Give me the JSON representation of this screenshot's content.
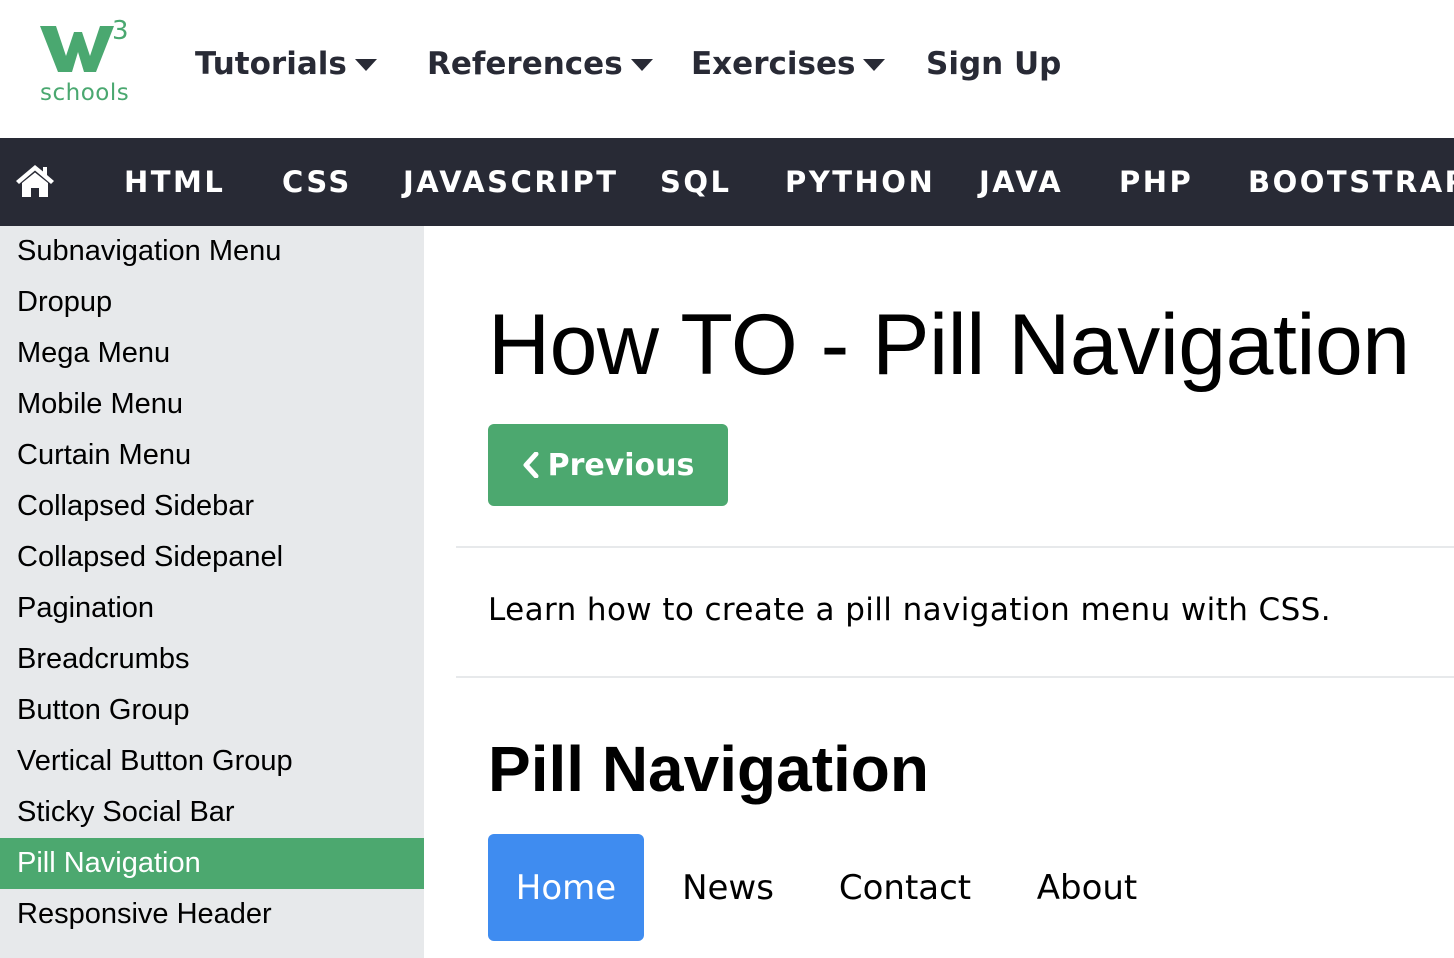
{
  "brand": {
    "logo_mark": "w",
    "logo_superscript": "3",
    "logo_text": "schools",
    "color": "#4aa870"
  },
  "topnav": {
    "items": [
      {
        "label": "Tutorials",
        "dropdown": true
      },
      {
        "label": "References",
        "dropdown": true
      },
      {
        "label": "Exercises",
        "dropdown": true
      },
      {
        "label": "Sign Up",
        "dropdown": false
      }
    ]
  },
  "darknav": {
    "home_icon": "home-icon",
    "items": [
      "HTML",
      "CSS",
      "JAVASCRIPT",
      "SQL",
      "PYTHON",
      "JAVA",
      "PHP",
      "BOOTSTRAP"
    ],
    "background": "#282a35"
  },
  "sidebar": {
    "items": [
      {
        "label": "Subnavigation Menu",
        "active": false
      },
      {
        "label": "Dropup",
        "active": false
      },
      {
        "label": "Mega Menu",
        "active": false
      },
      {
        "label": "Mobile Menu",
        "active": false
      },
      {
        "label": "Curtain Menu",
        "active": false
      },
      {
        "label": "Collapsed Sidebar",
        "active": false
      },
      {
        "label": "Collapsed Sidepanel",
        "active": false
      },
      {
        "label": "Pagination",
        "active": false
      },
      {
        "label": "Breadcrumbs",
        "active": false
      },
      {
        "label": "Button Group",
        "active": false
      },
      {
        "label": "Vertical Button Group",
        "active": false
      },
      {
        "label": "Sticky Social Bar",
        "active": false
      },
      {
        "label": "Pill Navigation",
        "active": true
      },
      {
        "label": "Responsive Header",
        "active": false
      }
    ],
    "active_color": "#4ca86f"
  },
  "main": {
    "title": "How TO - Pill Navigation",
    "previous_button": {
      "label": "Previous",
      "icon": "chevron-left-icon"
    },
    "intro": "Learn how to create a pill navigation menu with CSS.",
    "section_title": "Pill Navigation",
    "pills": [
      {
        "label": "Home",
        "active": true
      },
      {
        "label": "News",
        "active": false
      },
      {
        "label": "Contact",
        "active": false
      },
      {
        "label": "About",
        "active": false
      }
    ],
    "pill_active_color": "#3f8cf0"
  }
}
